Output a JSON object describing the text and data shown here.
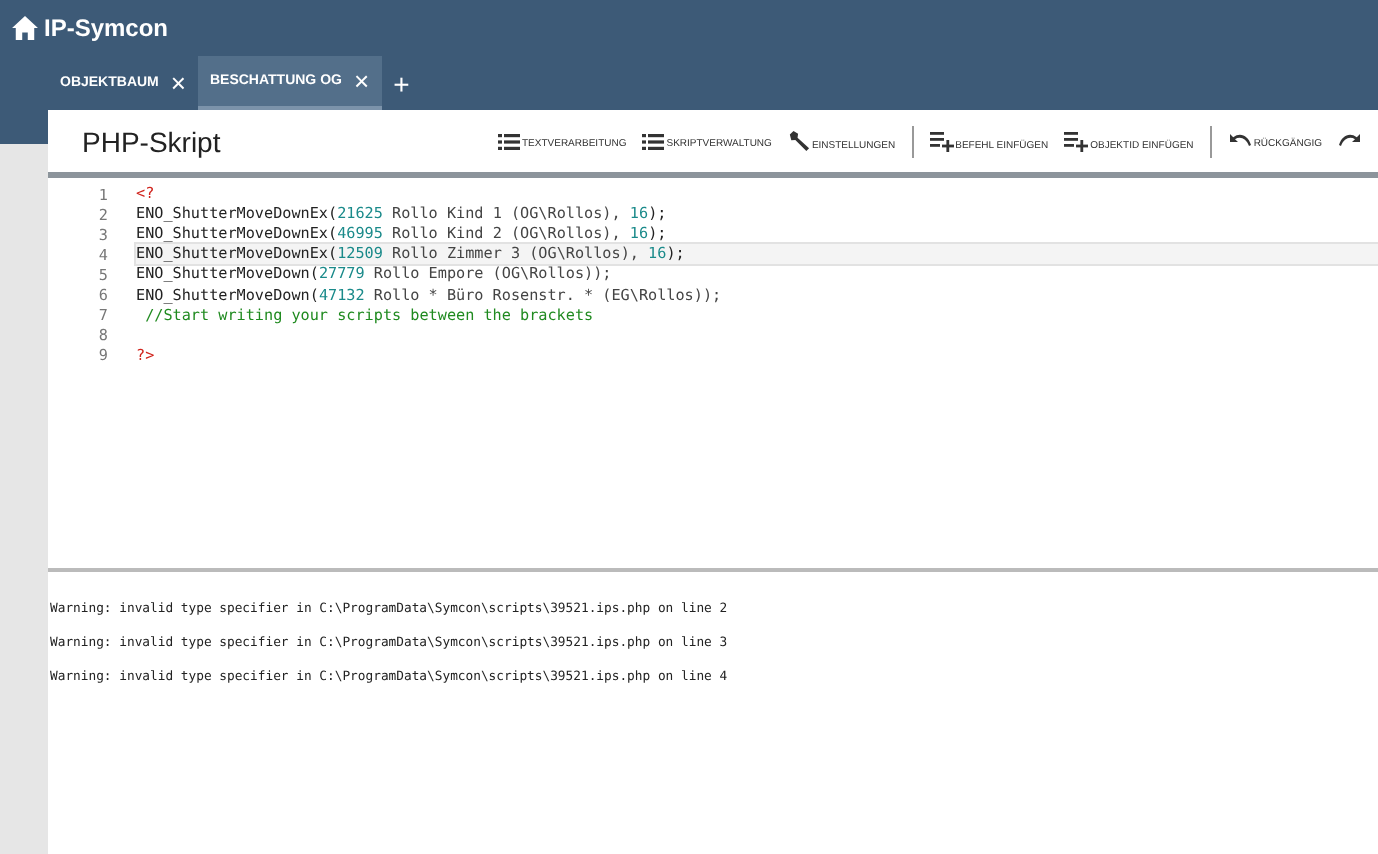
{
  "app": {
    "title": "IP-Symcon"
  },
  "tabs": [
    {
      "label": "OBJEKTBAUM",
      "close": "×",
      "selected": false
    },
    {
      "label": "BESCHATTUNG OG",
      "close": "×",
      "selected": true
    }
  ],
  "add_tab": "+",
  "panel": {
    "title": "PHP-Skript"
  },
  "toolbar": [
    {
      "kind": "list",
      "label": "TEXTVERARBEITUNG"
    },
    {
      "kind": "list",
      "label": "SKRIPTVERWALTUNG"
    },
    {
      "kind": "wrench",
      "label": "EINSTELLUNGEN"
    },
    {
      "kind": "separator"
    },
    {
      "kind": "insert",
      "label": "BEFEHL EINFÜGEN"
    },
    {
      "kind": "insert",
      "label": "OBJEKTID EINFÜGEN"
    },
    {
      "kind": "separator"
    },
    {
      "kind": "undo",
      "label": "RÜCKGÄNGIG"
    },
    {
      "kind": "redo"
    }
  ],
  "editor": {
    "lines": [
      {
        "number": "1",
        "current": false,
        "tokens": [
          {
            "kind": "tag",
            "text": "<?"
          }
        ]
      },
      {
        "number": "2",
        "current": false,
        "tokens": [
          {
            "kind": "fn",
            "text": "ENO_ShutterMoveDownEx("
          },
          {
            "kind": "num",
            "text": "21625"
          },
          {
            "kind": "text",
            "text": " Rollo Kind 1 (OG\\Rollos), "
          },
          {
            "kind": "num",
            "text": "16"
          },
          {
            "kind": "fn",
            "text": ");"
          }
        ]
      },
      {
        "number": "3",
        "current": false,
        "tokens": [
          {
            "kind": "fn",
            "text": "ENO_ShutterMoveDownEx("
          },
          {
            "kind": "num",
            "text": "46995"
          },
          {
            "kind": "text",
            "text": " Rollo Kind 2 (OG\\Rollos), "
          },
          {
            "kind": "num",
            "text": "16"
          },
          {
            "kind": "fn",
            "text": ");"
          }
        ]
      },
      {
        "number": "4",
        "current": true,
        "tokens": [
          {
            "kind": "fn",
            "text": "ENO_ShutterMoveDownEx("
          },
          {
            "kind": "num",
            "text": "12509"
          },
          {
            "kind": "text",
            "text": " Rollo Zimmer 3 (OG\\Rollos), "
          },
          {
            "kind": "num",
            "text": "16"
          },
          {
            "kind": "fn",
            "text": ");"
          }
        ]
      },
      {
        "number": "5",
        "current": false,
        "tokens": [
          {
            "kind": "fn",
            "text": "ENO_ShutterMoveDown("
          },
          {
            "kind": "num",
            "text": "27779"
          },
          {
            "kind": "text",
            "text": " Rollo Empore (OG\\Rollos));"
          }
        ]
      },
      {
        "number": "6",
        "current": false,
        "tokens": [
          {
            "kind": "fn",
            "text": "ENO_ShutterMoveDown("
          },
          {
            "kind": "num",
            "text": "47132"
          },
          {
            "kind": "text",
            "text": " Rollo * Büro Rosenstr. * (EG\\Rollos));"
          }
        ]
      },
      {
        "number": "7",
        "current": false,
        "tokens": [
          {
            "kind": "comment",
            "text": " //Start writing your scripts between the brackets"
          }
        ]
      },
      {
        "number": "8",
        "current": false
      },
      {
        "number": "9",
        "current": false,
        "tokens": [
          {
            "kind": "tag",
            "text": "?>"
          }
        ]
      }
    ]
  },
  "output": [
    "Warning: invalid type specifier in C:\\ProgramData\\Symcon\\scripts\\39521.ips.php on line 2",
    "Warning: invalid type specifier in C:\\ProgramData\\Symcon\\scripts\\39521.ips.php on line 3",
    "Warning: invalid type specifier in C:\\ProgramData\\Symcon\\scripts\\39521.ips.php on line 4"
  ]
}
